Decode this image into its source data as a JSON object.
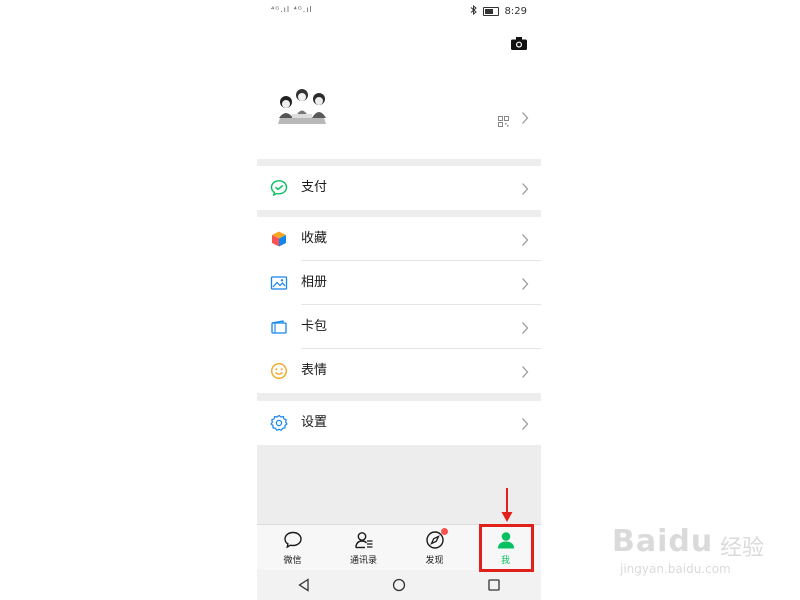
{
  "status_bar": {
    "signal": "⁴ᴳ.ıl ⁴ᴳ.ıl",
    "time": "8:29"
  },
  "profile": {
    "camera_icon": "camera-icon",
    "qr_icon": "qr-code-icon"
  },
  "menu": {
    "pay": {
      "label": "支付",
      "icon": "wechat-pay-icon",
      "color": "#07c160"
    },
    "favorites": {
      "label": "收藏",
      "icon": "cube-icon"
    },
    "album": {
      "label": "相册",
      "icon": "image-icon",
      "color": "#1485ee"
    },
    "cards": {
      "label": "卡包",
      "icon": "wallet-icon",
      "color": "#1485ee"
    },
    "stickers": {
      "label": "表情",
      "icon": "smile-icon",
      "color": "#f6a623"
    },
    "settings": {
      "label": "设置",
      "icon": "gear-icon",
      "color": "#1485ee"
    }
  },
  "tabbar": {
    "tabs": [
      {
        "label": "微信",
        "icon": "chat-bubble-icon"
      },
      {
        "label": "通讯录",
        "icon": "contacts-icon"
      },
      {
        "label": "发现",
        "icon": "compass-icon",
        "badge": true
      },
      {
        "label": "我",
        "icon": "person-icon",
        "active": true
      }
    ],
    "active_color": "#07c160"
  },
  "annotation": {
    "highlight_color": "#e0201a"
  },
  "watermark": {
    "brand": "Baidu",
    "brand_cn": "经验",
    "url": "jingyan.baidu.com"
  }
}
